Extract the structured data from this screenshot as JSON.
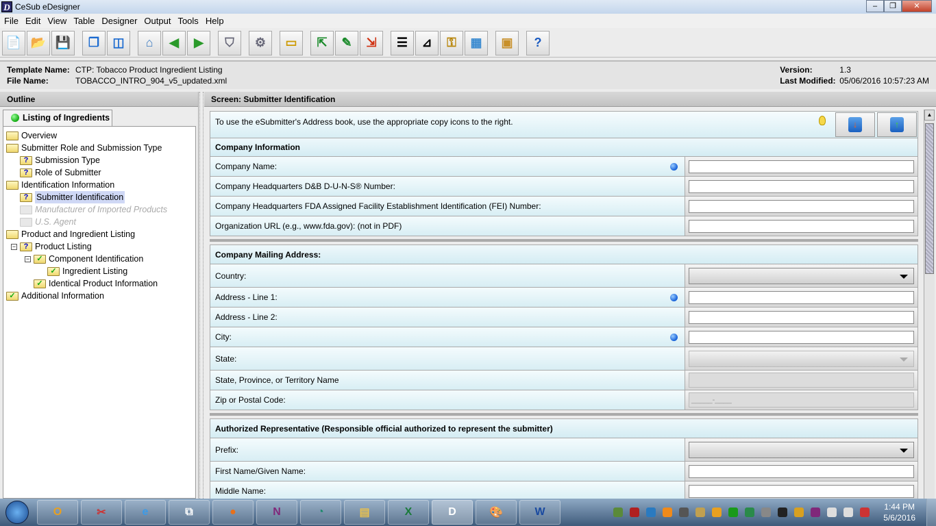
{
  "window": {
    "title": "CeSub eDesigner",
    "app_icon": "D",
    "controls": [
      "minimize",
      "restore",
      "close"
    ]
  },
  "menu": [
    "File",
    "Edit",
    "View",
    "Table",
    "Designer",
    "Output",
    "Tools",
    "Help"
  ],
  "toolbar": [
    {
      "name": "new-document",
      "glyph": "📄",
      "color": "#2a8a2a"
    },
    {
      "name": "open-folder",
      "glyph": "📂",
      "color": "#c90"
    },
    {
      "name": "save",
      "glyph": "💾",
      "color": "#1a4a9a"
    },
    {
      "name": "cascade-windows",
      "glyph": "❐",
      "color": "#1a6ad0",
      "gap": true
    },
    {
      "name": "split-view",
      "glyph": "◫",
      "color": "#1a6ad0"
    },
    {
      "name": "home",
      "glyph": "⌂",
      "color": "#3a7ac0",
      "gap": true
    },
    {
      "name": "back",
      "glyph": "◀",
      "color": "#2a9a2a"
    },
    {
      "name": "forward",
      "glyph": "▶",
      "color": "#2a9a2a"
    },
    {
      "name": "shield",
      "glyph": "⛉",
      "color": "#667",
      "gap": true
    },
    {
      "name": "gears",
      "glyph": "⚙",
      "color": "#667",
      "gap": true
    },
    {
      "name": "folder",
      "glyph": "▭",
      "color": "#c90",
      "gap": true
    },
    {
      "name": "import-document",
      "glyph": "⇱",
      "color": "#1a8a2a",
      "gap": true
    },
    {
      "name": "edit-document",
      "glyph": "✎",
      "color": "#1a8a2a"
    },
    {
      "name": "export-document",
      "glyph": "⇲",
      "color": "#d03010"
    },
    {
      "name": "form-list",
      "glyph": "☰",
      "color": "#000",
      "gap": true
    },
    {
      "name": "design-tool",
      "glyph": "⊿",
      "color": "#000"
    },
    {
      "name": "key",
      "glyph": "⚿",
      "color": "#b8860b"
    },
    {
      "name": "calculator",
      "glyph": "▦",
      "color": "#3a8ad0"
    },
    {
      "name": "package",
      "glyph": "▣",
      "color": "#c8902a",
      "gap": true
    },
    {
      "name": "help",
      "glyph": "?",
      "color": "#1a5ac0",
      "gap": true
    }
  ],
  "info": {
    "template_label": "Template Name:",
    "template_value": "CTP: Tobacco Product Ingredient Listing",
    "file_label": "File Name:",
    "file_value": "TOBACCO_INTRO_904_v5_updated.xml",
    "version_label": "Version:",
    "version_value": "1.3",
    "modified_label": "Last Modified:",
    "modified_value": "05/06/2016 10:57:23 AM"
  },
  "outline": {
    "title": "Outline",
    "tab": "Listing of Ingredients",
    "tab_status_color": "#22aa22",
    "nodes": [
      {
        "label": "Overview",
        "level": 0,
        "icon": "folder"
      },
      {
        "label": "Submitter Role and Submission Type",
        "level": 0,
        "icon": "folder"
      },
      {
        "label": "Submission Type",
        "level": 1,
        "icon": "folder-question"
      },
      {
        "label": "Role of Submitter",
        "level": 1,
        "icon": "folder-question"
      },
      {
        "label": "Identification Information",
        "level": 0,
        "icon": "folder"
      },
      {
        "label": "Submitter Identification",
        "level": 1,
        "icon": "folder-question",
        "selected": true
      },
      {
        "label": "Manufacturer of Imported Products",
        "level": 1,
        "icon": "folder-disabled",
        "disabled": true
      },
      {
        "label": "U.S. Agent",
        "level": 1,
        "icon": "folder-disabled",
        "disabled": true
      },
      {
        "label": "Product and Ingredient Listing",
        "level": 0,
        "icon": "folder"
      },
      {
        "label": "Product Listing",
        "level": 1,
        "icon": "folder-question",
        "expanded": true
      },
      {
        "label": "Component Identification",
        "level": 2,
        "icon": "folder-check",
        "expanded": true
      },
      {
        "label": "Ingredient Listing",
        "level": 3,
        "icon": "folder-check"
      },
      {
        "label": "Identical Product Information",
        "level": 2,
        "icon": "folder-check"
      },
      {
        "label": "Additional Information",
        "level": 0,
        "icon": "folder-check"
      }
    ]
  },
  "screen": {
    "title": "Screen: Submitter Identification",
    "instruction": "To use the eSubmitter's Address book, use the appropriate copy icons to the right.",
    "address_book_buttons": [
      "copy-from-address-book",
      "copy-to-address-book"
    ],
    "sections": [
      {
        "title": "Company Information",
        "fields": [
          {
            "label": "Company Name:",
            "type": "text",
            "required": true,
            "value": ""
          },
          {
            "label": "Company Headquarters D&B D-U-N-S® Number:",
            "type": "text",
            "value": ""
          },
          {
            "label": "Company Headquarters FDA Assigned Facility Establishment Identification (FEI) Number:",
            "type": "text",
            "value": ""
          },
          {
            "label": "Organization URL (e.g., www.fda.gov): (not in PDF)",
            "type": "text",
            "value": ""
          }
        ]
      },
      {
        "title": "Company Mailing Address:",
        "fields": [
          {
            "label": "Country:",
            "type": "select",
            "value": ""
          },
          {
            "label": "Address - Line 1:",
            "type": "text",
            "required": true,
            "value": ""
          },
          {
            "label": "Address - Line 2:",
            "type": "text",
            "value": ""
          },
          {
            "label": "City:",
            "type": "text",
            "required": true,
            "value": ""
          },
          {
            "label": "State:",
            "type": "select",
            "disabled": true,
            "value": ""
          },
          {
            "label": "State, Province, or Territory Name",
            "type": "text",
            "disabled": true,
            "value": ""
          },
          {
            "label": "Zip or Postal Code:",
            "type": "text",
            "disabled": true,
            "value": "_____-____"
          }
        ]
      },
      {
        "title": "Authorized Representative (Responsible official authorized to represent the submitter)",
        "fields": [
          {
            "label": "Prefix:",
            "type": "select",
            "value": ""
          },
          {
            "label": "First Name/Given Name:",
            "type": "text",
            "value": ""
          },
          {
            "label": "Middle Name:",
            "type": "text",
            "value": ""
          }
        ]
      }
    ]
  },
  "taskbar": {
    "apps": [
      {
        "name": "outlook",
        "glyph": "O",
        "color": "#e8a020"
      },
      {
        "name": "snipping-tool",
        "glyph": "✂",
        "color": "#c33"
      },
      {
        "name": "internet-explorer",
        "glyph": "e",
        "color": "#3a9ae8"
      },
      {
        "name": "remote-desktop",
        "glyph": "⧉",
        "color": "#fff"
      },
      {
        "name": "firefox",
        "glyph": "●",
        "color": "#e8701a"
      },
      {
        "name": "onenote",
        "glyph": "N",
        "color": "#80287a"
      },
      {
        "name": "app-circle",
        "glyph": "◔",
        "color": "#1a8a6a"
      },
      {
        "name": "file-explorer",
        "glyph": "▤",
        "color": "#e8c050"
      },
      {
        "name": "excel",
        "glyph": "X",
        "color": "#1a7a3a"
      },
      {
        "name": "cesub-edesigner",
        "glyph": "D",
        "color": "#fff",
        "active": true
      },
      {
        "name": "paint",
        "glyph": "🎨",
        "color": "#fff"
      },
      {
        "name": "word",
        "glyph": "W",
        "color": "#1a4aa0"
      }
    ],
    "tray": [
      "#5a8a3a",
      "#b02020",
      "#2a7ac0",
      "#f08a1a",
      "#555",
      "#c0a050",
      "#e8a020",
      "#1a9a1a",
      "#2a8a4a",
      "#888",
      "#222",
      "#d8a020",
      "#80287a",
      "#ddd",
      "#ddd",
      "#c33"
    ],
    "time": "1:44 PM",
    "date": "5/6/2016"
  }
}
